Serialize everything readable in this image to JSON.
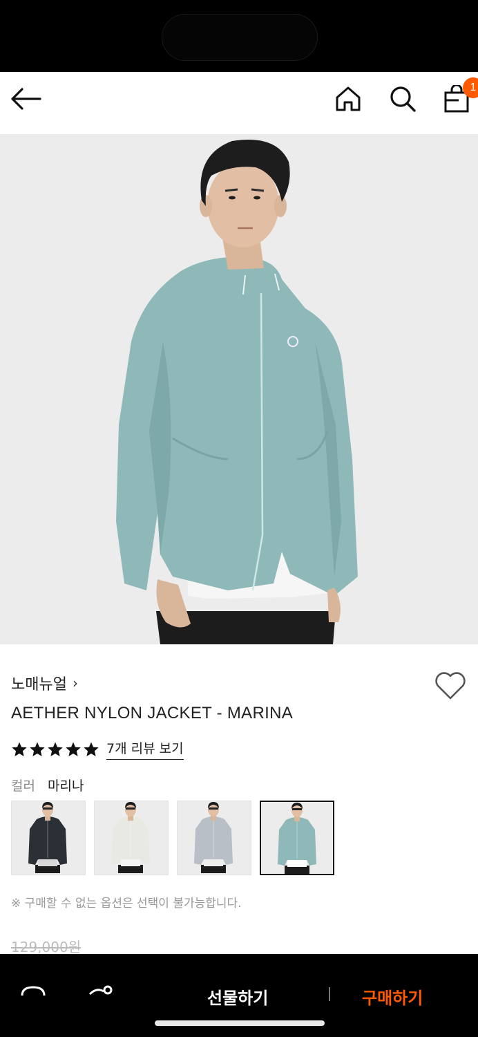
{
  "header": {
    "icons": [
      "back-arrow-icon",
      "home-icon",
      "search-icon",
      "shopping-bag-icon"
    ],
    "cart_count": "1"
  },
  "product": {
    "brand": "노매뉴얼",
    "brand_chevron": "›",
    "name": "AETHER NYLON JACKET - MARINA",
    "rating": 5,
    "reviews_link": "7개 리뷰 보기",
    "color_label": "컬러",
    "color_value": "마리나",
    "color_options": [
      {
        "name": "black",
        "jacket_color": "#2b2f36",
        "inner": "#d8d8d8"
      },
      {
        "name": "ivory",
        "jacket_color": "#e9e9e4",
        "inner": "#f4f4f4"
      },
      {
        "name": "grey",
        "jacket_color": "#b9bfc6",
        "inner": "#eeeeee"
      },
      {
        "name": "marina",
        "jacket_color": "#8fb9b9",
        "inner": "#ffffff",
        "selected": true
      }
    ],
    "notice": "※ 구매할 수 없는 옵션은 선택이 불가능합니다.",
    "original_price": "129,000원"
  },
  "bottom_bar": {
    "gift_label": "선물하기",
    "buy_label": "구매하기"
  },
  "colors": {
    "accent": "#ff5a00",
    "jacket": "#8fb9b9"
  }
}
